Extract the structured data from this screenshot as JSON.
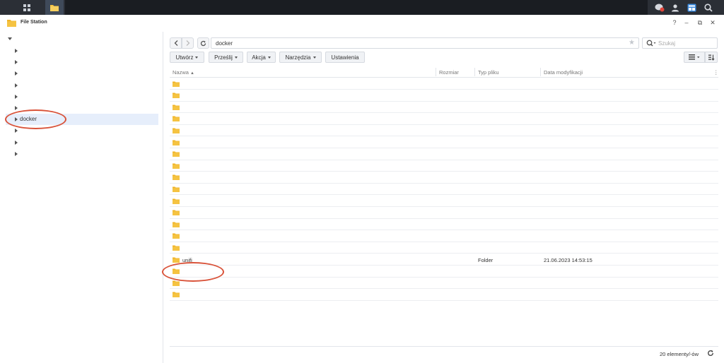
{
  "taskbar": {
    "icons": [
      "grid-icon",
      "file-station-icon",
      "chat-icon",
      "user-icon",
      "widget-icon",
      "search-icon"
    ]
  },
  "window": {
    "title": "File Station",
    "controls": {
      "help": "?",
      "minimize": "–",
      "restore": "⧉",
      "close": "✕"
    }
  },
  "tree": {
    "items": [
      {
        "label": ""
      },
      {
        "label": ""
      },
      {
        "label": ""
      },
      {
        "label": ""
      },
      {
        "label": ""
      },
      {
        "label": ""
      },
      {
        "label": "docker",
        "selected": true
      },
      {
        "label": ""
      },
      {
        "label": ""
      },
      {
        "label": ""
      }
    ]
  },
  "navigation": {
    "path": "docker",
    "search_placeholder": "Szukaj"
  },
  "toolbar": {
    "create_label": "Utwórz",
    "upload_label": "Prześlij",
    "action_label": "Akcja",
    "tools_label": "Narzędzia",
    "settings_label": "Ustawienia"
  },
  "table": {
    "columns": {
      "name": "Nazwa",
      "size": "Rozmiar",
      "type": "Typ pliku",
      "modified": "Data modyfikacji"
    },
    "rows": [
      {
        "name": "",
        "type": "",
        "modified": ""
      },
      {
        "name": "",
        "type": "",
        "modified": ""
      },
      {
        "name": "",
        "type": "",
        "modified": ""
      },
      {
        "name": "",
        "type": "",
        "modified": ""
      },
      {
        "name": "",
        "type": "",
        "modified": ""
      },
      {
        "name": "",
        "type": "",
        "modified": ""
      },
      {
        "name": "",
        "type": "",
        "modified": ""
      },
      {
        "name": "",
        "type": "",
        "modified": ""
      },
      {
        "name": "",
        "type": "",
        "modified": ""
      },
      {
        "name": "",
        "type": "",
        "modified": ""
      },
      {
        "name": "",
        "type": "",
        "modified": ""
      },
      {
        "name": "",
        "type": "",
        "modified": ""
      },
      {
        "name": "",
        "type": "",
        "modified": ""
      },
      {
        "name": "",
        "type": "",
        "modified": ""
      },
      {
        "name": "",
        "type": "",
        "modified": ""
      },
      {
        "name": "unifi",
        "type": "Folder",
        "modified": "21.06.2023 14:53:15"
      },
      {
        "name": "",
        "type": "",
        "modified": ""
      },
      {
        "name": "",
        "type": "",
        "modified": ""
      },
      {
        "name": "",
        "type": "",
        "modified": ""
      }
    ]
  },
  "footer": {
    "count": "20 elementy/-ów"
  },
  "colors": {
    "annotation": "#d9533a",
    "folder": "#f5c342",
    "selection": "#e6eefb"
  }
}
